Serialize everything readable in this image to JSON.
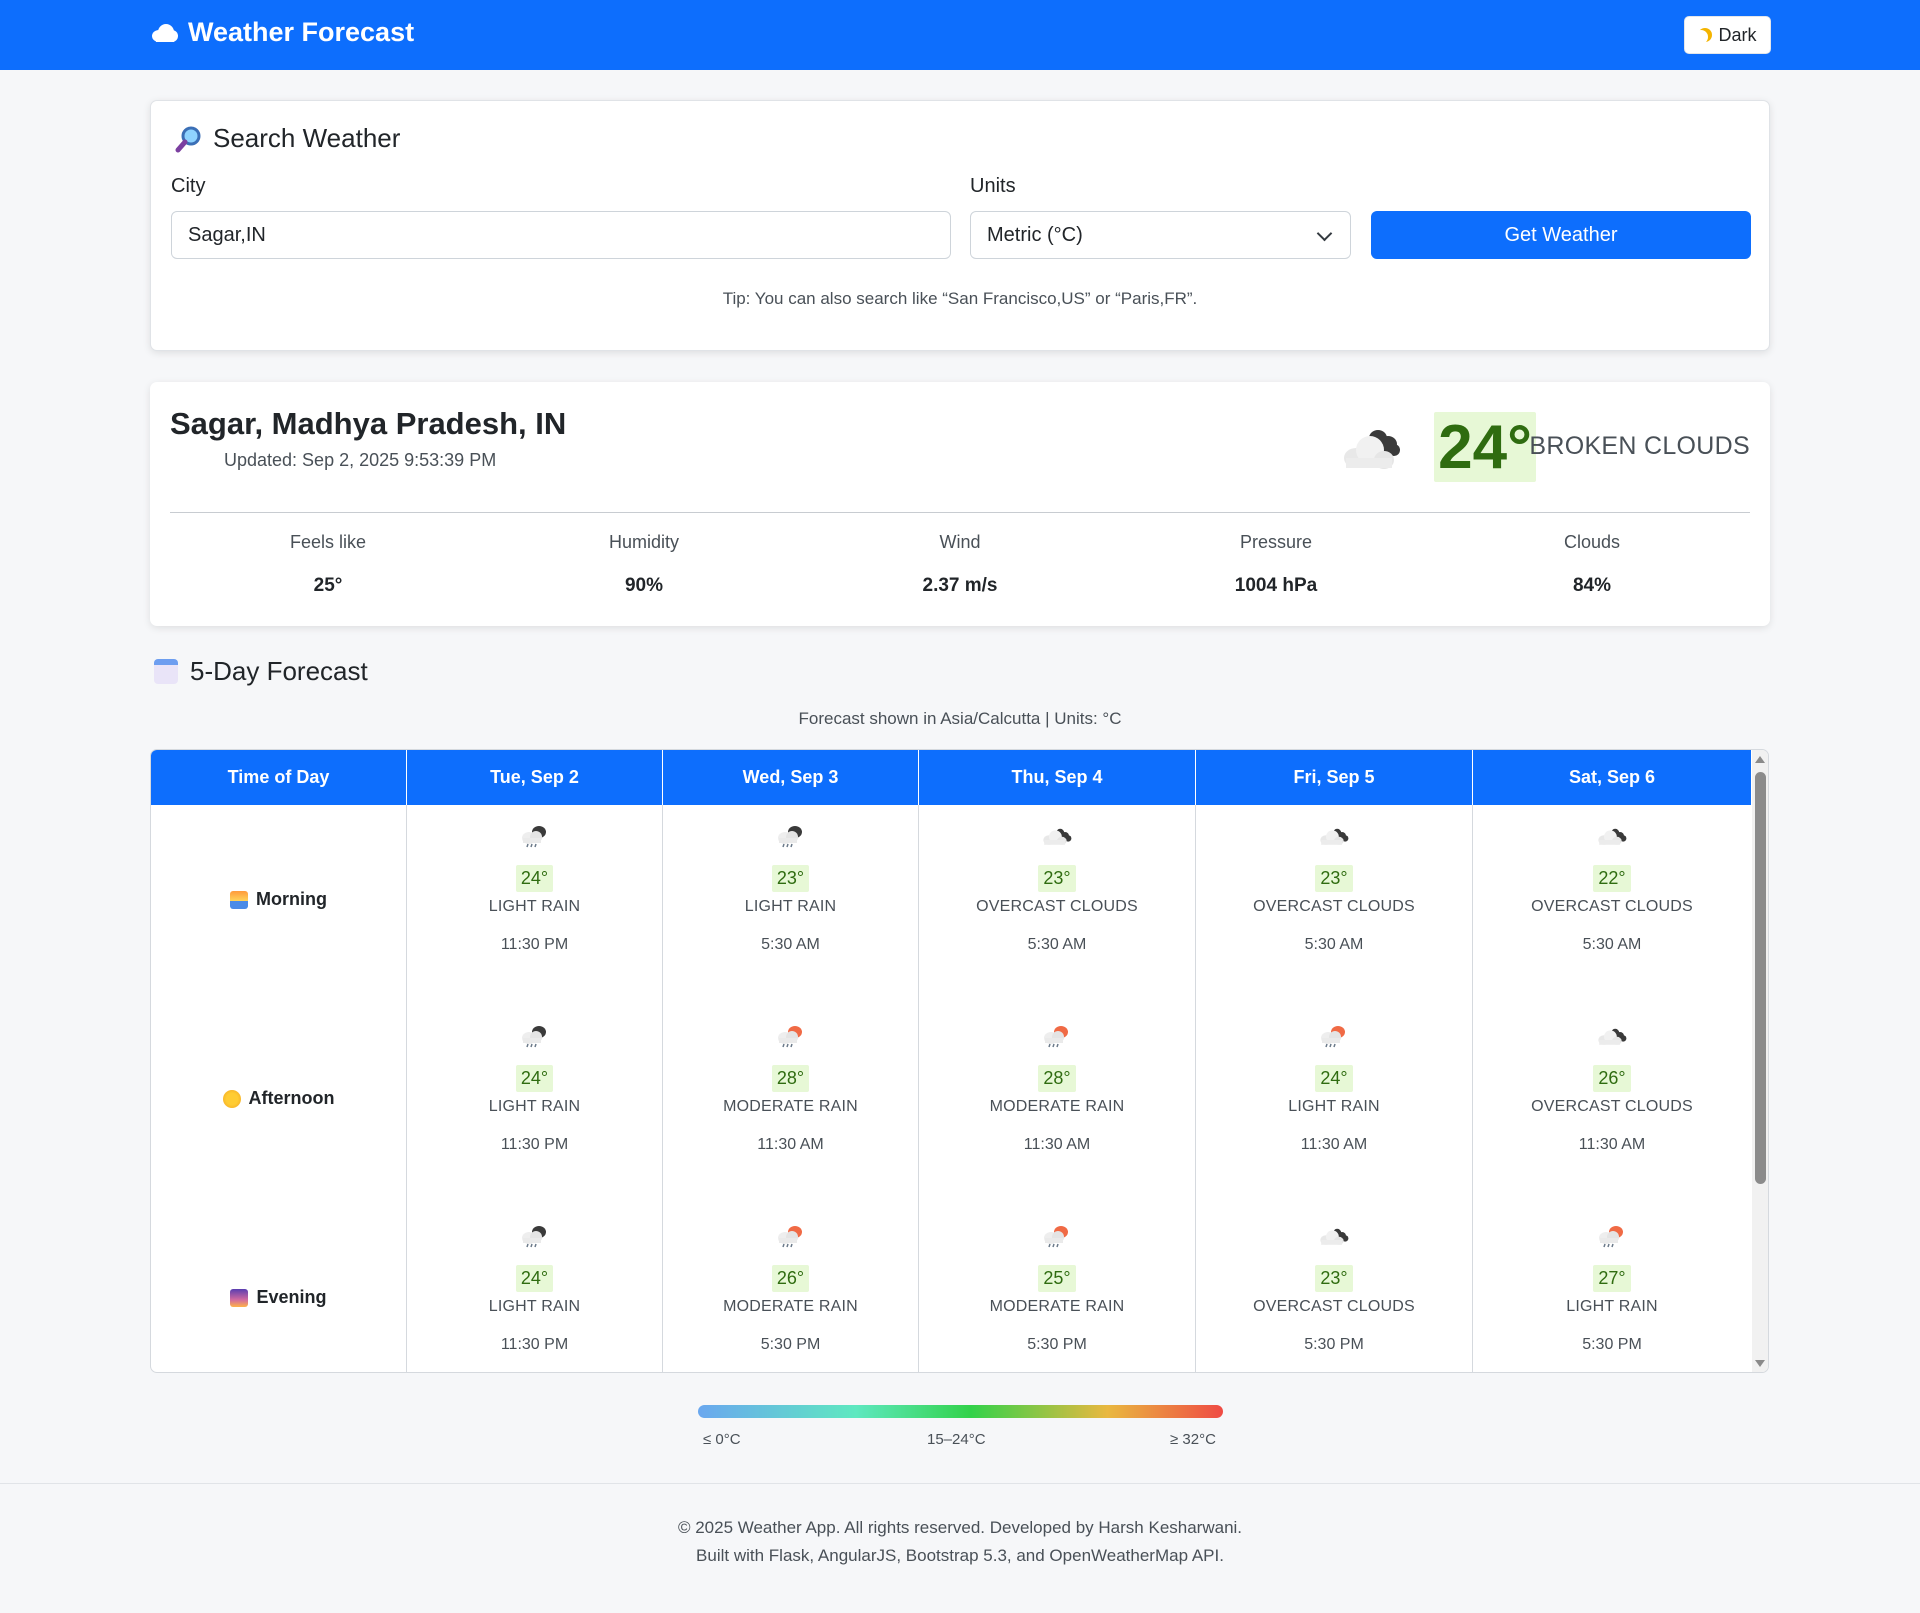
{
  "navbar": {
    "brand_text": "Weather Forecast",
    "theme_button_label": "Dark"
  },
  "search": {
    "title": "Search Weather",
    "city_label": "City",
    "city_value": "Sagar,IN",
    "units_label": "Units",
    "units_value": "Metric (°C)",
    "button_label": "Get Weather",
    "tip": "Tip: You can also search like “San Francisco,US” or “Paris,FR”."
  },
  "current": {
    "location": "Sagar, Madhya Pradesh, IN",
    "updated": "Updated: Sep 2, 2025 9:53:39 PM",
    "icon": "broken-clouds-icon",
    "temp": "24°",
    "description": "BROKEN CLOUDS",
    "stats": [
      {
        "label": "Feels like",
        "value": "25°"
      },
      {
        "label": "Humidity",
        "value": "90%"
      },
      {
        "label": "Wind",
        "value": "2.37 m/s"
      },
      {
        "label": "Pressure",
        "value": "1004 hPa"
      },
      {
        "label": "Clouds",
        "value": "84%"
      }
    ]
  },
  "forecast": {
    "title": "5-Day Forecast",
    "subtitle": "Forecast shown in Asia/Calcutta  |  Units: °C",
    "time_header": "Time of Day",
    "times_of_day": [
      "Morning",
      "Afternoon",
      "Evening"
    ],
    "days": [
      {
        "label": "Tue, Sep 2",
        "slots": [
          {
            "icon": "rain-night-icon",
            "temp": "24°",
            "desc": "LIGHT RAIN",
            "time": "11:30 PM"
          },
          {
            "icon": "rain-night-icon",
            "temp": "24°",
            "desc": "LIGHT RAIN",
            "time": "11:30 PM"
          },
          {
            "icon": "rain-night-icon",
            "temp": "24°",
            "desc": "LIGHT RAIN",
            "time": "11:30 PM"
          }
        ]
      },
      {
        "label": "Wed, Sep 3",
        "slots": [
          {
            "icon": "rain-night-icon",
            "temp": "23°",
            "desc": "LIGHT RAIN",
            "time": "5:30 AM"
          },
          {
            "icon": "rain-day-icon",
            "temp": "28°",
            "desc": "MODERATE RAIN",
            "time": "11:30 AM"
          },
          {
            "icon": "rain-day-icon",
            "temp": "26°",
            "desc": "MODERATE RAIN",
            "time": "5:30 PM"
          }
        ]
      },
      {
        "label": "Thu, Sep 4",
        "slots": [
          {
            "icon": "overcast-clouds-icon",
            "temp": "23°",
            "desc": "OVERCAST CLOUDS",
            "time": "5:30 AM"
          },
          {
            "icon": "rain-day-icon",
            "temp": "28°",
            "desc": "MODERATE RAIN",
            "time": "11:30 AM"
          },
          {
            "icon": "rain-day-icon",
            "temp": "25°",
            "desc": "MODERATE RAIN",
            "time": "5:30 PM"
          }
        ]
      },
      {
        "label": "Fri, Sep 5",
        "slots": [
          {
            "icon": "overcast-clouds-icon",
            "temp": "23°",
            "desc": "OVERCAST CLOUDS",
            "time": "5:30 AM"
          },
          {
            "icon": "rain-day-icon",
            "temp": "24°",
            "desc": "LIGHT RAIN",
            "time": "11:30 AM"
          },
          {
            "icon": "overcast-clouds-icon",
            "temp": "23°",
            "desc": "OVERCAST CLOUDS",
            "time": "5:30 PM"
          }
        ]
      },
      {
        "label": "Sat, Sep 6",
        "slots": [
          {
            "icon": "overcast-clouds-icon",
            "temp": "22°",
            "desc": "OVERCAST CLOUDS",
            "time": "5:30 AM"
          },
          {
            "icon": "overcast-clouds-icon",
            "temp": "26°",
            "desc": "OVERCAST CLOUDS",
            "time": "11:30 AM"
          },
          {
            "icon": "rain-day-icon",
            "temp": "27°",
            "desc": "LIGHT RAIN",
            "time": "5:30 PM"
          }
        ]
      }
    ]
  },
  "legend": {
    "low": "≤ 0°C",
    "mid": "15–24°C",
    "high": "≥ 32°C",
    "colors": [
      "#6aa7ef",
      "#5ee8c0",
      "#32d24a",
      "#e9b840",
      "#ef4b44"
    ]
  },
  "footer": {
    "line1": "© 2025 Weather App. All rights reserved. Developed by Harsh Kesharwani.",
    "line2": "Built with Flask, AngularJS, Bootstrap 5.3, and OpenWeatherMap API."
  },
  "colors": {
    "primary": "#0d6efd",
    "temp_badge_bg": "#e7f8d6",
    "temp_badge_text": "#2f6c10"
  }
}
